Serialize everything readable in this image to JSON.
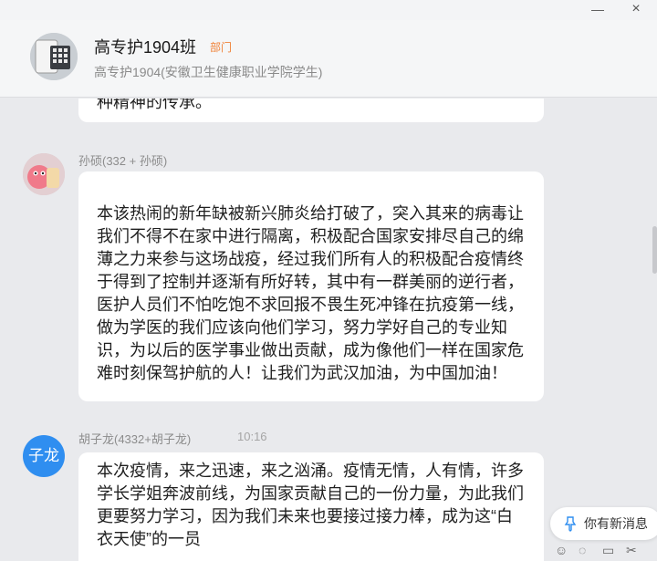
{
  "header": {
    "group_name": "高专护1904班",
    "badge": "部门",
    "subtitle": "高专护1904(安徽卫生健康职业学院学生)"
  },
  "messages": [
    {
      "text": "种精神的传承。"
    },
    {
      "sender": "孙硕(332 + 孙硕)",
      "text": "本该热闹的新年缺被新兴肺炎给打破了，突入其来的病毒让我们不得不在家中进行隔离，积极配合国家安排尽自己的绵薄之力来参与这场战疫，经过我们所有人的积极配合疫情终于得到了控制并逐渐有所好转，其中有一群美丽的逆行者，医护人员们不怕吃饱不求回报不畏生死冲锋在抗疫第一线，做为学医的我们应该向他们学习，努力学好自己的专业知识，为以后的医学事业做出贡献，成为像他们一样在国家危难时刻保驾护航的人！让我们为武汉加油，为中国加油！"
    },
    {
      "sender": "胡子龙(4332+胡子龙)",
      "avatar_text": "子龙",
      "time": "10:16",
      "text": "本次疫情，来之迅速，来之汹涌。疫情无情，人有情，许多学长学姐奔波前线，为国家贡献自己的一份力量，为此我们更要努力学习，因为我们未来也要接过接力棒，成为这“白衣天使”的一员"
    }
  ],
  "new_message": "你有新消息",
  "colors": {
    "accent": "#2f8ef0",
    "badge": "#f0833a",
    "chat_bg": "#e9eaed"
  }
}
